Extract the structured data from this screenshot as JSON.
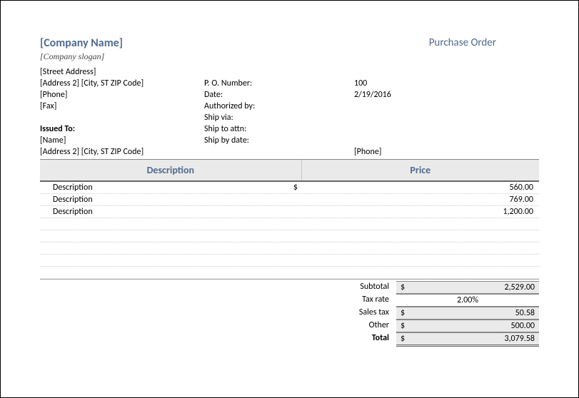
{
  "header": {
    "company_name": "[Company Name]",
    "doc_title": "Purchase Order",
    "slogan": "[Company slogan]"
  },
  "address": {
    "street": "[Street Address]",
    "line2": "[Address 2] [City, ST ZIP Code]",
    "phone": "[Phone]",
    "fax": "[Fax]"
  },
  "po": {
    "number_label": "P. O. Number:",
    "number_value": "100",
    "date_label": "Date:",
    "date_value": "2/19/2016",
    "authorized_label": "Authorized by:",
    "authorized_value": "",
    "ship_via_label": "Ship via:",
    "ship_via_value": "",
    "ship_attn_label": "Ship to attn:",
    "ship_attn_value": "",
    "ship_by_label": "Ship by date:",
    "ship_by_value": ""
  },
  "issued": {
    "label": "Issued To:",
    "name": "[Name]",
    "address": "[Address 2] [City, ST ZIP Code]",
    "phone": "[Phone]"
  },
  "table": {
    "header_desc": "Description",
    "header_price": "Price",
    "currency": "$",
    "rows": [
      {
        "desc": "Description",
        "price": "560.00",
        "show_currency": true
      },
      {
        "desc": "Description",
        "price": "769.00",
        "show_currency": false
      },
      {
        "desc": "Description",
        "price": "1,200.00",
        "show_currency": false
      }
    ]
  },
  "totals": {
    "subtotal_label": "Subtotal",
    "subtotal_value": "2,529.00",
    "taxrate_label": "Tax rate",
    "taxrate_value": "2.00%",
    "salestax_label": "Sales tax",
    "salestax_value": "50.58",
    "other_label": "Other",
    "other_value": "500.00",
    "total_label": "Total",
    "total_value": "3,079.58",
    "currency": "$"
  }
}
